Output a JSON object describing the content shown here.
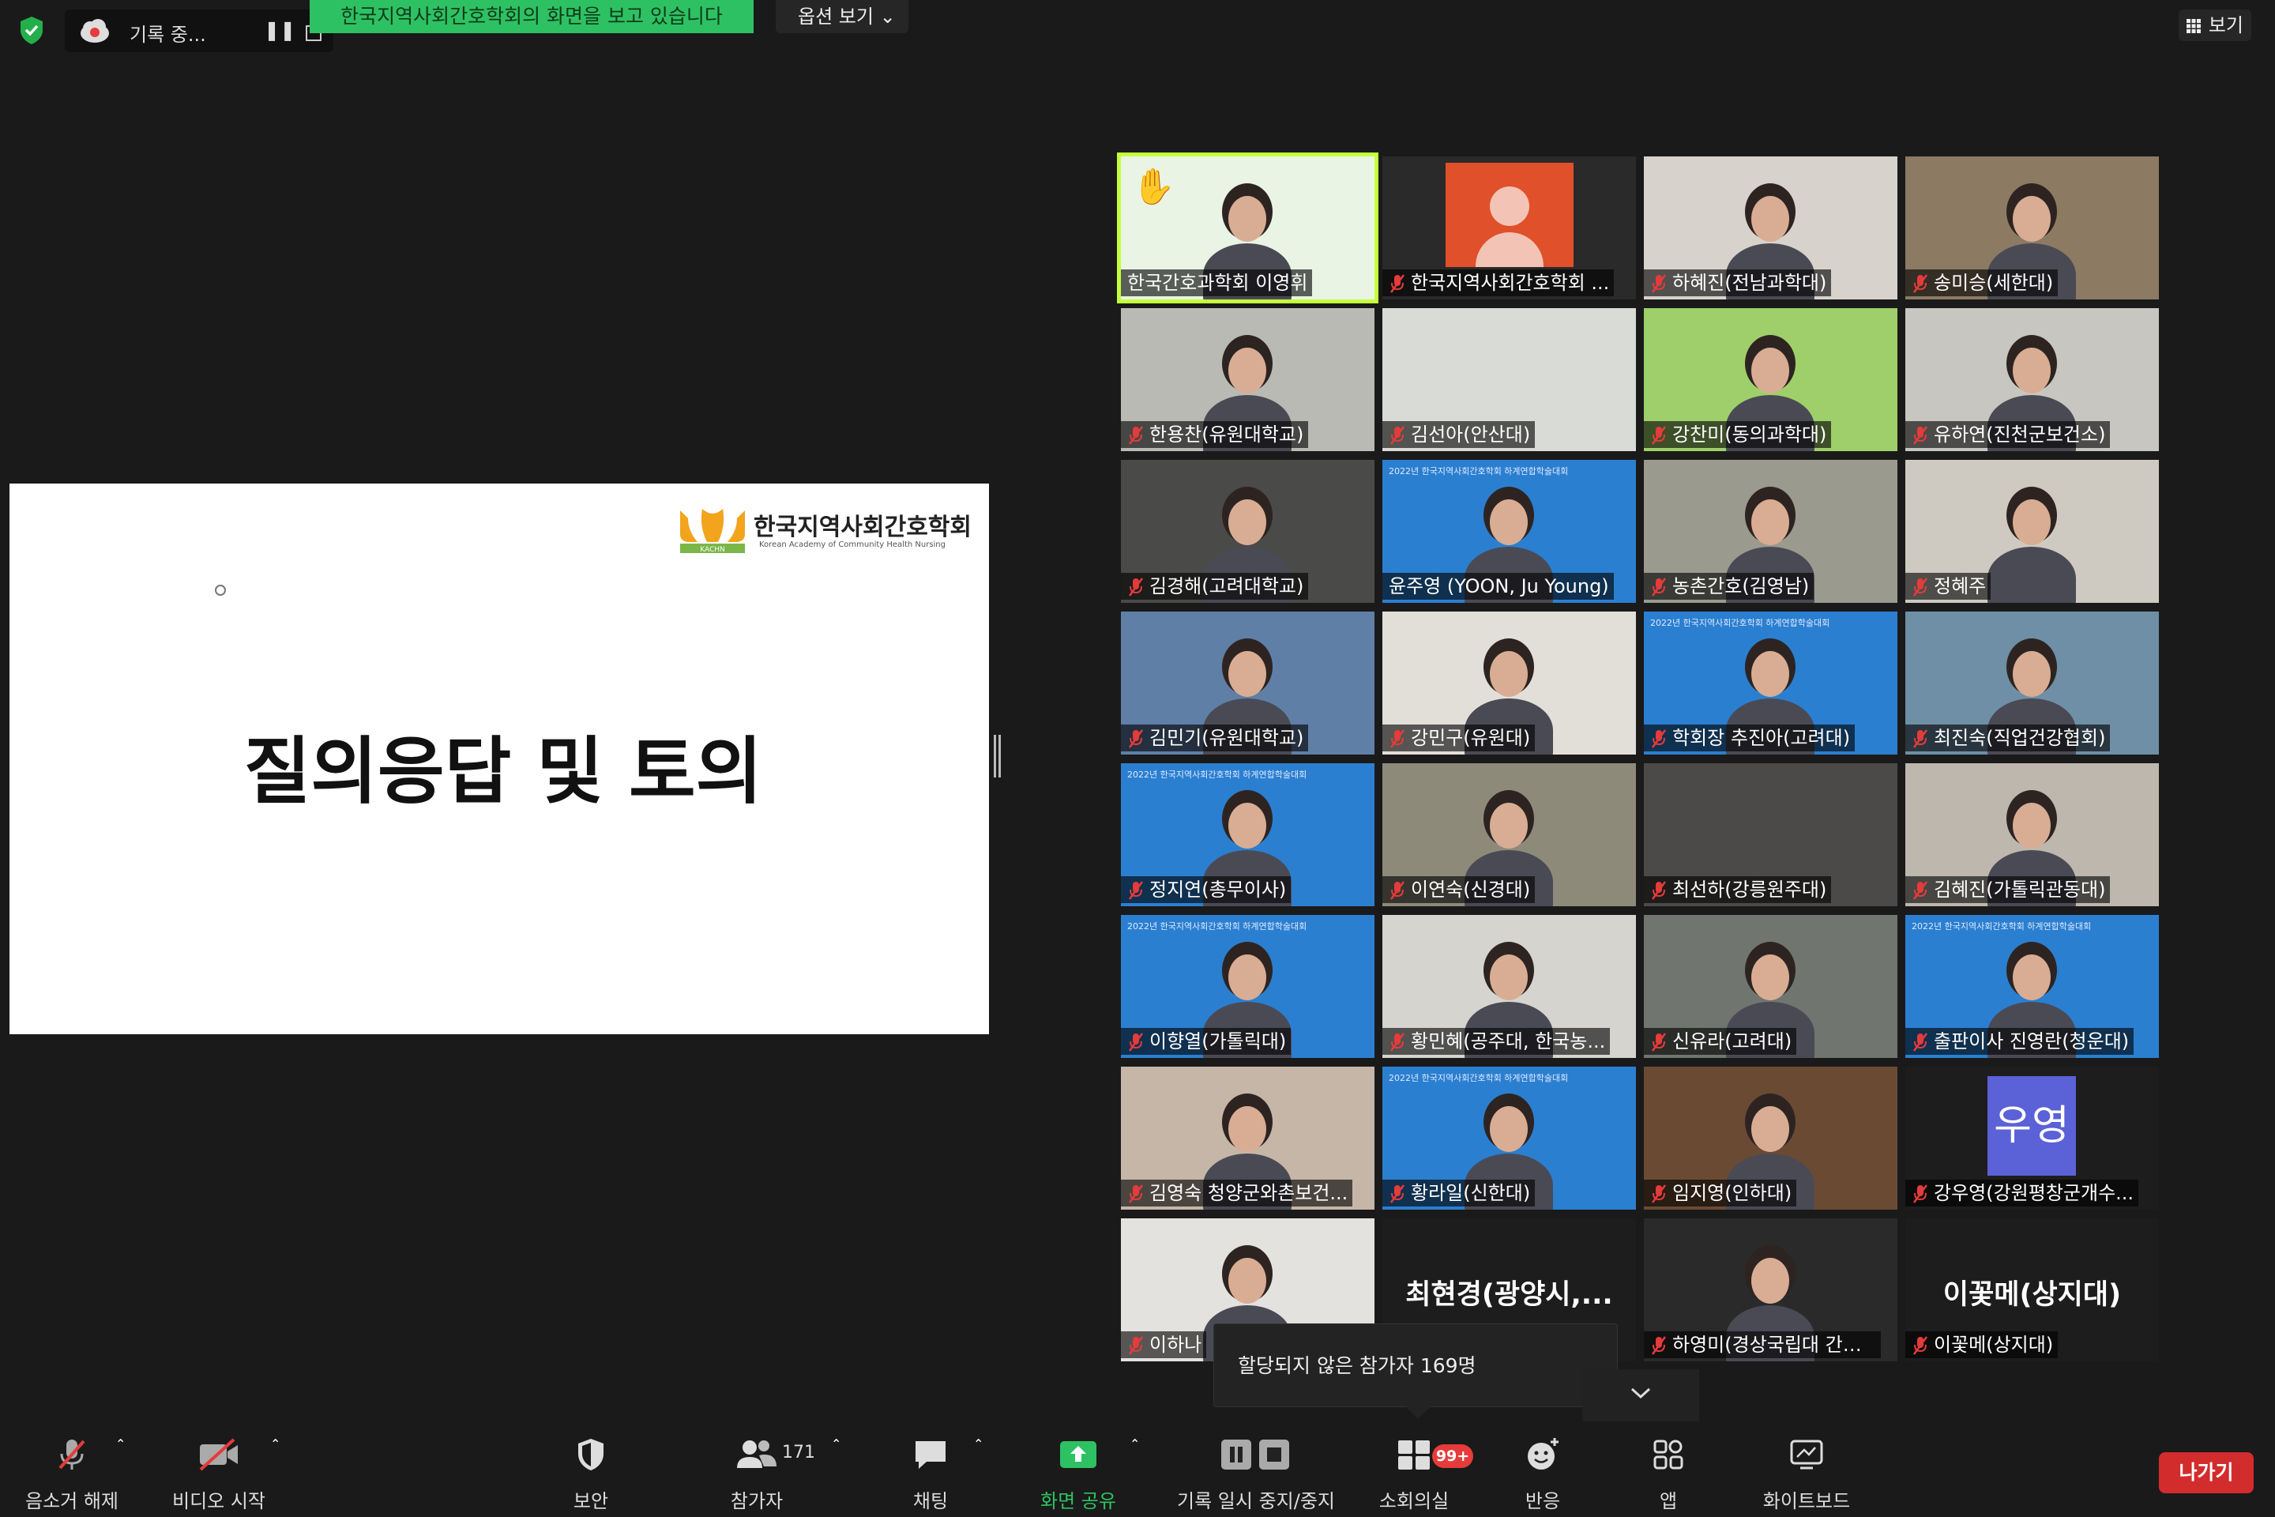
{
  "top": {
    "record_label": "기록 중...",
    "viewing_banner": "한국지역사회간호학회의 화면을 보고 있습니다",
    "view_options": "옵션 보기",
    "view_button": "보기"
  },
  "slide": {
    "org_name_ko": "한국지역사회간호학회",
    "org_name_en": "Korean Academy of Community Health Nursing",
    "logo_text": "KACHN",
    "title": "질의응답 및 토의"
  },
  "participants": [
    {
      "name": "한국간호과학회 이영휘",
      "muted": false,
      "hand_raised": true,
      "active_speaker": true
    },
    {
      "name": "한국지역사회간호학회 ...",
      "muted": true
    },
    {
      "name": "하혜진(전남과학대)",
      "muted": true
    },
    {
      "name": "송미승(세한대)",
      "muted": true
    },
    {
      "name": "한용찬(유원대학교)",
      "muted": true
    },
    {
      "name": "김선아(안산대)",
      "muted": true
    },
    {
      "name": "강찬미(동의과학대)",
      "muted": true
    },
    {
      "name": "유하연(진천군보건소)",
      "muted": true
    },
    {
      "name": "김경해(고려대학교)",
      "muted": true
    },
    {
      "name": "윤주영 (YOON, Ju Young)",
      "muted": false
    },
    {
      "name": "농촌간호(김영남)",
      "muted": true
    },
    {
      "name": "정혜주",
      "muted": true
    },
    {
      "name": "김민기(유원대학교)",
      "muted": true
    },
    {
      "name": "강민구(유원대)",
      "muted": true
    },
    {
      "name": "학회장 추진아(고려대)",
      "muted": true
    },
    {
      "name": "최진숙(직업건강협회)",
      "muted": true
    },
    {
      "name": "정지연(총무이사)",
      "muted": true
    },
    {
      "name": "이연숙(신경대)",
      "muted": true
    },
    {
      "name": "최선하(강릉원주대)",
      "muted": true
    },
    {
      "name": "김혜진(가톨릭관동대)",
      "muted": true
    },
    {
      "name": "이향열(가톨릭대)",
      "muted": true
    },
    {
      "name": "황민혜(공주대, 한국농...",
      "muted": true
    },
    {
      "name": "신유라(고려대)",
      "muted": true
    },
    {
      "name": "출판이사 진영란(청운대)",
      "muted": true
    },
    {
      "name": "김영숙 청양군와촌보건...",
      "muted": true
    },
    {
      "name": "황라일(신한대)",
      "muted": true
    },
    {
      "name": "임지영(인하대)",
      "muted": true
    },
    {
      "name": "강우영(강원평창군개수...",
      "muted": true,
      "avatar_text": "우영"
    },
    {
      "name": "이하나",
      "muted": true
    },
    {
      "name": "최현경(광양시,...",
      "muted": false,
      "video_off": true
    },
    {
      "name": "하영미(경상국립대 간호...",
      "muted": true
    },
    {
      "name": "이꽃메(상지대)",
      "muted": true,
      "display_big": "이꽃메(상지대)"
    }
  ],
  "banner_text": "2022년 한국지역사회간호학회 하계연합학술대회",
  "tooltip": "할당되지 않은 참가자 169명",
  "toolbar": {
    "unmute": "음소거 해제",
    "start_video": "비디오 시작",
    "security": "보안",
    "participants": "참가자",
    "participant_count": "171",
    "chat": "채팅",
    "share_screen": "화면 공유",
    "record_pause_stop": "기록 일시 중지/중지",
    "breakout": "소회의실",
    "breakout_badge": "99+",
    "reactions": "반응",
    "apps": "앱",
    "whiteboard": "화이트보드",
    "leave": "나가기"
  },
  "colors": {
    "share_green": "#2ec163",
    "active_outline": "#c5ff3a",
    "leave_red": "#d32c2c",
    "mute_red": "#e53b3b",
    "avatar_orange": "#e0502a",
    "avatar_purple": "#5b61d6",
    "banner_blue": "#2b7fd0"
  }
}
